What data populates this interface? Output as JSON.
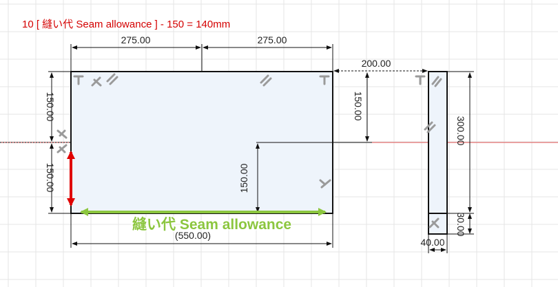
{
  "annotation": {
    "formula": "10 [ 縫い代 Seam allowance ] - 150 = 140mm",
    "seam_label": "縫い代 Seam allowance"
  },
  "dimensions": {
    "top_left": "275.00",
    "top_right": "275.00",
    "gap": "200.00",
    "left_upper": "150.00",
    "left_lower": "150.00",
    "right_inner": "150.00",
    "center": "150.00",
    "total_width": "(550.00)",
    "strip_height": "300.00",
    "strip_bottom": "30.00",
    "strip_width": "40.00"
  },
  "colors": {
    "part_fill": "#eef4fb",
    "axis_red": "#e05050",
    "annotation_red": "#d40000",
    "annotation_green": "#8cc63f",
    "arrow_red": "#e00000",
    "arrow_green": "#8cc63f"
  },
  "icons": {
    "constraint": "perpendicular-icon",
    "parallel": "parallel-icon"
  }
}
